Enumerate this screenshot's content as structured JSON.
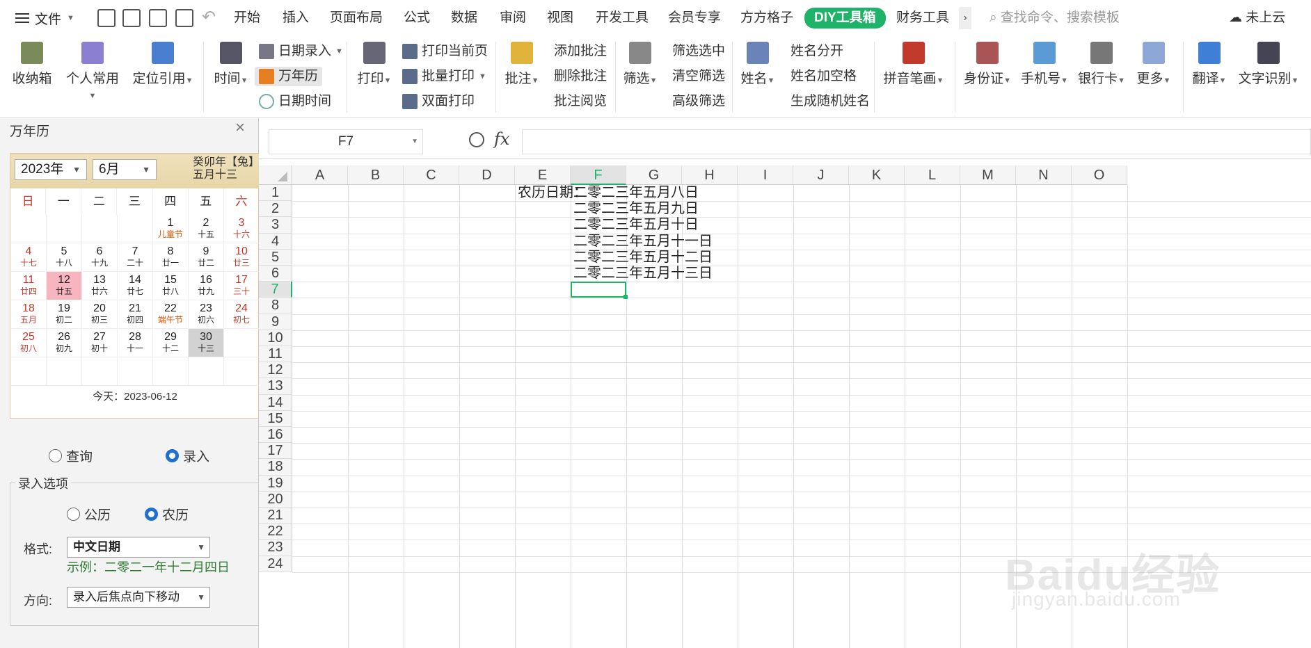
{
  "title_bar": {
    "file_menu": "文件",
    "tabs": [
      "开始",
      "插入",
      "页面布局",
      "公式",
      "数据",
      "审阅",
      "视图",
      "开发工具",
      "会员专享",
      "方方格子",
      "DIY工具箱",
      "财务工具"
    ],
    "more": "›",
    "search_placeholder": "查找命令、搜索模板",
    "cloud_status": "未上云"
  },
  "ribbon": {
    "storage": "收纳箱",
    "personal": "个人常用",
    "locate_ref": "定位引用",
    "time": "时间",
    "date_entry": "日期录入",
    "perpetual_calendar": "万年历",
    "date_time": "日期时间",
    "print": "打印",
    "print_current": "打印当前页",
    "batch_print": "批量打印",
    "duplex_print": "双面打印",
    "annotate": "批注",
    "add_annotation": "添加批注",
    "delete_annotation": "删除批注",
    "annotation_browse": "批注阅览",
    "filter": "筛选",
    "filter_selected": "筛选选中",
    "clear_filter": "清空筛选",
    "advanced_filter": "高级筛选",
    "name": "姓名",
    "split_name": "姓名分开",
    "name_add_space": "姓名加空格",
    "random_name": "生成随机姓名",
    "pinyin_strokes": "拼音笔画",
    "id_card": "身份证",
    "mobile": "手机号",
    "bank_card": "银行卡",
    "more": "更多",
    "translate": "翻译",
    "ocr": "文字识别"
  },
  "pane": {
    "title": "万年历",
    "close": "×",
    "year": "2023年",
    "month": "6月",
    "lunar_year": "癸卯年【兔】",
    "lunar_date": "五月十三",
    "weekdays": [
      "日",
      "一",
      "二",
      "三",
      "四",
      "五",
      "六"
    ],
    "days": [
      {
        "d": "1",
        "l": "儿童节",
        "hol": true
      },
      {
        "d": "2",
        "l": "十五"
      },
      {
        "d": "3",
        "l": "十六"
      },
      {
        "d": "4",
        "l": "十七"
      },
      {
        "d": "5",
        "l": "十八"
      },
      {
        "d": "6",
        "l": "十九"
      },
      {
        "d": "7",
        "l": "二十"
      },
      {
        "d": "8",
        "l": "廿一"
      },
      {
        "d": "9",
        "l": "廿二"
      },
      {
        "d": "10",
        "l": "廿三"
      },
      {
        "d": "11",
        "l": "廿四"
      },
      {
        "d": "12",
        "l": "廿五",
        "today": true
      },
      {
        "d": "13",
        "l": "廿六"
      },
      {
        "d": "14",
        "l": "廿七"
      },
      {
        "d": "15",
        "l": "廿八"
      },
      {
        "d": "16",
        "l": "廿九"
      },
      {
        "d": "17",
        "l": "三十"
      },
      {
        "d": "18",
        "l": "五月"
      },
      {
        "d": "19",
        "l": "初二"
      },
      {
        "d": "20",
        "l": "初三"
      },
      {
        "d": "21",
        "l": "初四"
      },
      {
        "d": "22",
        "l": "端午节",
        "hol": true
      },
      {
        "d": "23",
        "l": "初六"
      },
      {
        "d": "24",
        "l": "初七"
      },
      {
        "d": "25",
        "l": "初八"
      },
      {
        "d": "26",
        "l": "初九"
      },
      {
        "d": "27",
        "l": "初十"
      },
      {
        "d": "28",
        "l": "十一"
      },
      {
        "d": "29",
        "l": "十二"
      },
      {
        "d": "30",
        "l": "十三",
        "sel": true
      }
    ],
    "today_text": "今天：2023-06-12",
    "mode_query": "查询",
    "mode_entry": "录入",
    "group_title": "录入选项",
    "gregorian": "公历",
    "lunar": "农历",
    "format_label": "格式:",
    "format_value": "中文日期",
    "example": "示例：二零二一年十二月四日",
    "direction_label": "方向:",
    "direction_value": "录入后焦点向下移动"
  },
  "sheet": {
    "name_box": "F7",
    "fx": "fx",
    "columns": [
      "A",
      "B",
      "C",
      "D",
      "E",
      "F",
      "G",
      "H",
      "I",
      "J",
      "K",
      "L",
      "M",
      "N",
      "O"
    ],
    "rows": [
      "1",
      "2",
      "3",
      "4",
      "5",
      "6",
      "7",
      "8",
      "9",
      "10",
      "11",
      "12",
      "13",
      "14",
      "15",
      "16",
      "17",
      "18",
      "19",
      "20",
      "21",
      "22",
      "23",
      "24"
    ],
    "e1_label": "农历日期：",
    "f_values": [
      "二零二三年五月八日",
      "二零二三年五月九日",
      "二零二三年五月十日",
      "二零二三年五月十一日",
      "二零二三年五月十二日",
      "二零二三年五月十三日"
    ]
  },
  "watermark": {
    "brand": "Baidu经验",
    "url": "jingyan.baidu.com"
  }
}
